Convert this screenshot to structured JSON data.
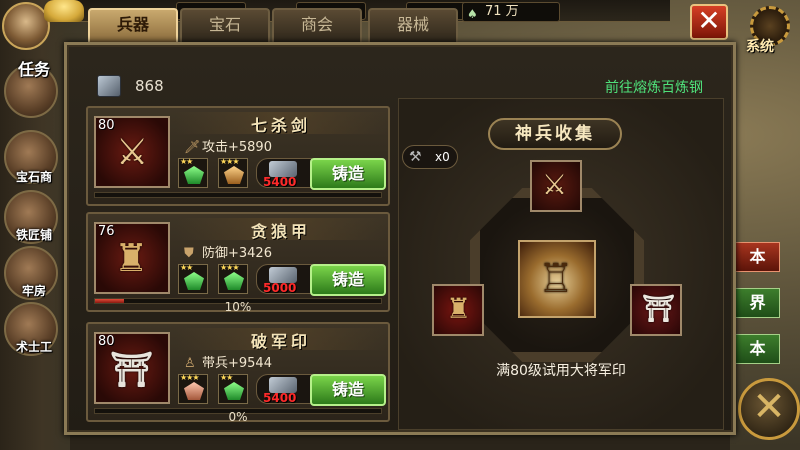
{
  "header": {
    "currency_value": "71 万",
    "system_label": "系统",
    "close_glyph": "✕"
  },
  "tabs": [
    {
      "label": "兵器",
      "active": true
    },
    {
      "label": "宝石",
      "active": false
    },
    {
      "label": "商会",
      "active": false
    },
    {
      "label": "器械",
      "active": false
    }
  ],
  "side_menu": {
    "items": [
      "任务",
      "宝石商",
      "铁匠铺",
      "牢房",
      "术士工"
    ]
  },
  "right_side_menu": {
    "items": [
      "本",
      "界",
      "本"
    ]
  },
  "panel": {
    "iron_count": "868",
    "goto_link": "前往熔炼百炼钢"
  },
  "equipment": [
    {
      "level": "80",
      "name": "七杀剑",
      "stat_label": "攻击+5890",
      "stat_icon": "sword-icon",
      "gems": [
        "green",
        "amber"
      ],
      "cost": "5400",
      "forge_label": "铸造",
      "progress": 0.0,
      "progress_label": ""
    },
    {
      "level": "76",
      "name": "贪狼甲",
      "stat_label": "防御+3426",
      "stat_icon": "shield-icon",
      "gems": [
        "green",
        "green"
      ],
      "cost": "5000",
      "forge_label": "铸造",
      "progress": 0.1,
      "progress_label": "10%"
    },
    {
      "level": "80",
      "name": "破军印",
      "stat_label": "带兵+9544",
      "stat_icon": "soldier-icon",
      "gems": [
        "pink",
        "green"
      ],
      "cost": "5400",
      "forge_label": "铸造",
      "progress": 0.0,
      "progress_label": "0%"
    }
  ],
  "collection": {
    "title": "神兵收集",
    "hammer_count": "x0",
    "unlock_text": "满80级试用大将军印"
  },
  "colors": {
    "forge_button": "#4fa62a",
    "cost_red": "#ff2a2a",
    "link_green": "#4fe07a",
    "accent_gold": "#c9a96e"
  }
}
